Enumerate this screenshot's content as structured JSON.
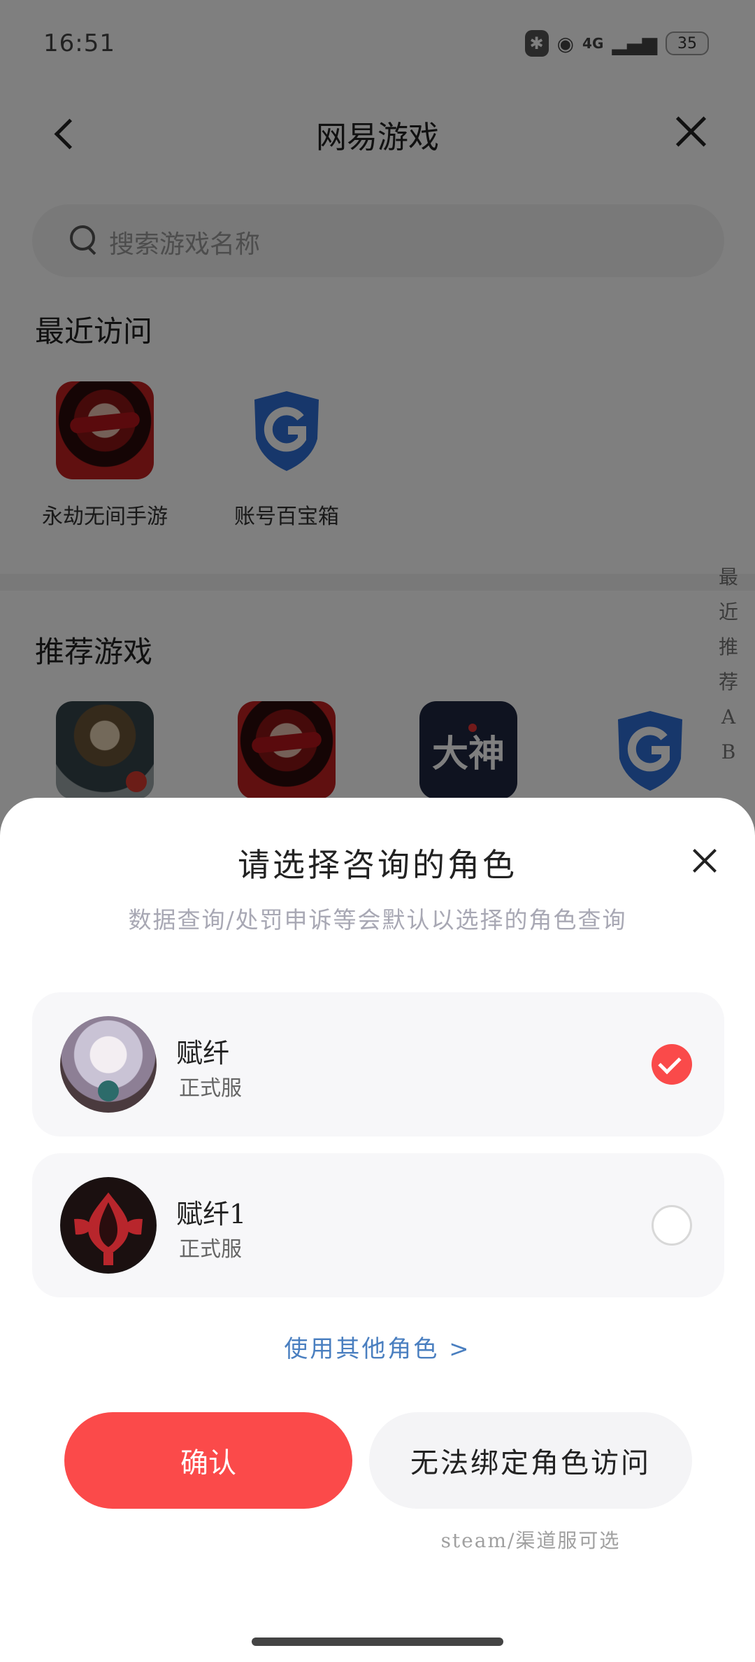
{
  "status_bar": {
    "time": "16:51",
    "network": "4G",
    "battery": "35"
  },
  "nav": {
    "title": "网易游戏"
  },
  "search": {
    "placeholder": "搜索游戏名称"
  },
  "recent": {
    "title": "最近访问",
    "items": [
      {
        "label": "永劫无间手游",
        "icon": "game-icon-yongjie"
      },
      {
        "label": "账号百宝箱",
        "icon": "shield-g-icon"
      }
    ]
  },
  "recommended": {
    "title": "推荐游戏",
    "items": [
      {
        "icon": "game-icon-identity-v"
      },
      {
        "icon": "game-icon-yongjie"
      },
      {
        "icon": "dashen-icon",
        "text": "大神"
      },
      {
        "icon": "shield-g-icon"
      }
    ]
  },
  "index_bar": [
    "最",
    "近",
    "推",
    "荐",
    "A",
    "B"
  ],
  "sheet": {
    "title": "请选择咨询的角色",
    "subtitle": "数据查询/处罚申诉等会默认以选择的角色查询",
    "roles": [
      {
        "name": "赋纤",
        "server": "正式服",
        "selected": true
      },
      {
        "name": "赋纤1",
        "server": "正式服",
        "selected": false
      }
    ],
    "other_role_link": "使用其他角色 >",
    "confirm_label": "确认",
    "unbound_label": "无法绑定角色访问",
    "unbound_hint": "steam/渠道服可选"
  },
  "colors": {
    "accent_red": "#fb4a4a",
    "link_blue": "#4a7fc0",
    "shield_blue": "#2f6fd6"
  }
}
